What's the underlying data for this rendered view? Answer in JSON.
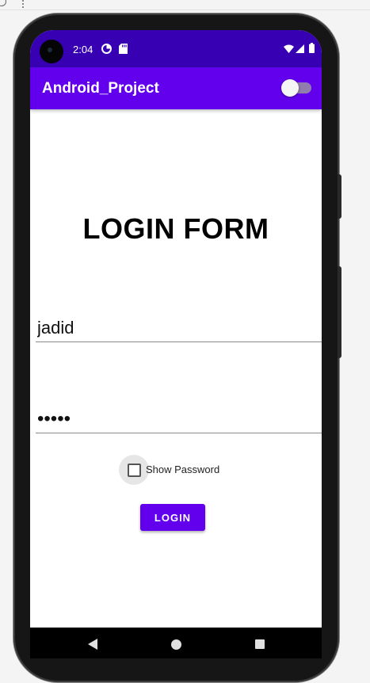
{
  "status_bar": {
    "time": "2:04"
  },
  "app_bar": {
    "title": "Android_Project",
    "toggle_on": false
  },
  "form": {
    "heading": "LOGIN FORM",
    "username_value": "jadid",
    "password_value": "•••••",
    "show_password_label": "Show Password",
    "show_password_checked": false,
    "login_button_label": "LOGIN"
  },
  "colors": {
    "status_bar": "#3700b3",
    "app_bar": "#6200ee",
    "button": "#6200ee"
  },
  "icons": {
    "status": [
      "camera-icon",
      "data-saver-icon",
      "sd-card-icon",
      "wifi-icon",
      "signal-icon",
      "battery-icon"
    ],
    "nav": [
      "back-icon",
      "home-icon",
      "recents-icon"
    ]
  }
}
